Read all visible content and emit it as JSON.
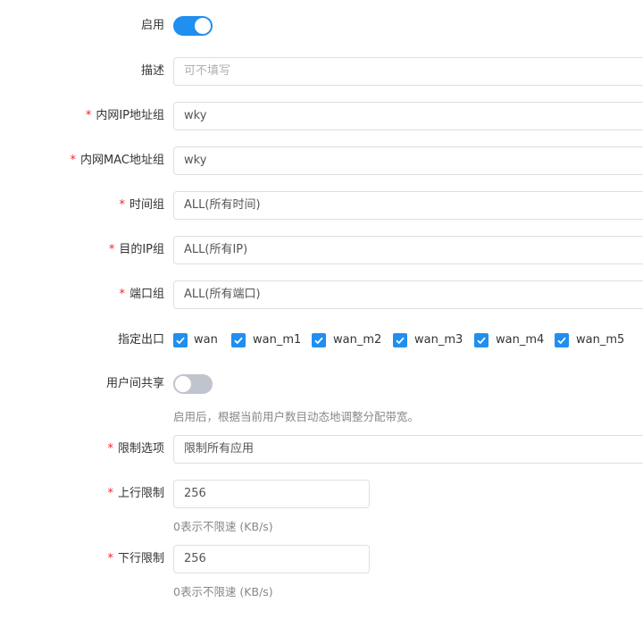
{
  "form": {
    "enable": {
      "label": "启用",
      "on": true
    },
    "description": {
      "label": "描述",
      "value": "",
      "placeholder": "可不填写"
    },
    "ip_group": {
      "label": "内网IP地址组",
      "value": "wky"
    },
    "mac_group": {
      "label": "内网MAC地址组",
      "value": "wky"
    },
    "time_group": {
      "label": "时间组",
      "value": "ALL(所有时间)"
    },
    "dest_ip": {
      "label": "目的IP组",
      "value": "ALL(所有IP)"
    },
    "port_group": {
      "label": "端口组",
      "value": "ALL(所有端口)"
    },
    "outlet": {
      "label": "指定出口",
      "options": [
        {
          "label": "wan",
          "checked": true
        },
        {
          "label": "wan_m1",
          "checked": true
        },
        {
          "label": "wan_m2",
          "checked": true
        },
        {
          "label": "wan_m3",
          "checked": true
        },
        {
          "label": "wan_m4",
          "checked": true
        },
        {
          "label": "wan_m5",
          "checked": true
        }
      ]
    },
    "share": {
      "label": "用户间共享",
      "on": false,
      "hint": "启用后，根据当前用户数目动态地调整分配带宽。"
    },
    "limit_option": {
      "label": "限制选项",
      "value": "限制所有应用"
    },
    "upload": {
      "label": "上行限制",
      "value": "256",
      "hint": "0表示不限速 (KB/s)"
    },
    "download": {
      "label": "下行限制",
      "value": "256",
      "hint": "0表示不限速 (KB/s)"
    }
  },
  "colors": {
    "accent": "#1f8ff0",
    "required": "#f5222d",
    "switch_off": "#c0c4cc"
  },
  "icons": {
    "checkbox": "check-icon"
  }
}
